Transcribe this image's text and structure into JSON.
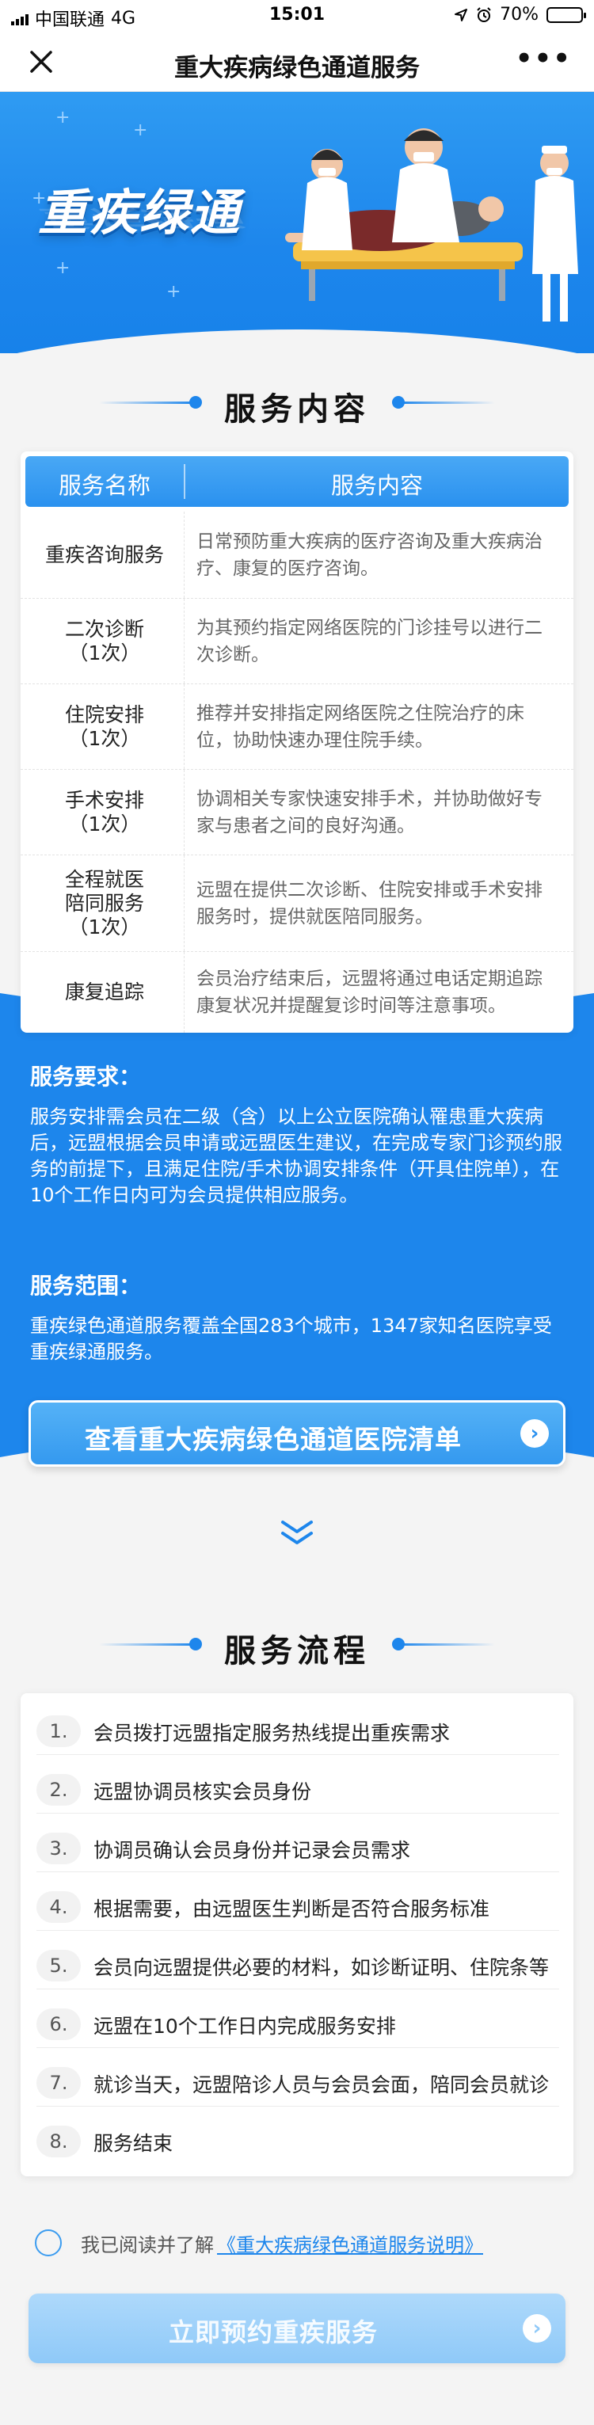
{
  "status_bar": {
    "carrier": "中国联通",
    "network": "4G",
    "time": "15:01",
    "battery": "70%",
    "battery_level": 0.7
  },
  "nav": {
    "title": "重大疾病绿色通道服务",
    "more": "•••"
  },
  "banner": {
    "title": "重疾绿通"
  },
  "service_section": {
    "heading": "服务内容",
    "header_name": "服务名称",
    "header_content": "服务内容",
    "rows": [
      {
        "name": "重疾咨询服务",
        "desc": "日常预防重大疾病的医疗咨询及重大疾病治疗、康复的医疗咨询。"
      },
      {
        "name": "二次诊断\n（1次）",
        "desc": "为其预约指定网络医院的门诊挂号以进行二次诊断。"
      },
      {
        "name": "住院安排\n（1次）",
        "desc": "推荐并安排指定网络医院之住院治疗的床位，协助快速办理住院手续。"
      },
      {
        "name": "手术安排\n（1次）",
        "desc": "协调相关专家快速安排手术，并协助做好专家与患者之间的良好沟通。"
      },
      {
        "name": "全程就医\n陪同服务\n（1次）",
        "desc": "远盟在提供二次诊断、住院安排或手术安排服务时，提供就医陪同服务。"
      },
      {
        "name": "康复追踪",
        "desc": "会员治疗结束后，远盟将通过电话定期追踪康复状况并提醒复诊时间等注意事项。"
      }
    ]
  },
  "requirement": {
    "title": "服务要求：",
    "text": "服务安排需会员在二级（含）以上公立医院确认罹患重大疾病后，远盟根据会员申请或远盟医生建议，在完成专家门诊预约服务的前提下，且满足住院/手术协调安排条件（开具住院单），在10个工作日内可为会员提供相应服务。"
  },
  "scope": {
    "title": "服务范围：",
    "text": "重疾绿色通道服务覆盖全国283个城市，1347家知名医院享受重疾绿通服务。"
  },
  "hospital_button": {
    "label": "查看重大疾病绿色通道医院清单"
  },
  "process_section": {
    "heading": "服务流程",
    "steps": [
      {
        "num": "1.",
        "text": "会员拨打远盟指定服务热线提出重疾需求"
      },
      {
        "num": "2.",
        "text": "远盟协调员核实会员身份"
      },
      {
        "num": "3.",
        "text": "协调员确认会员身份并记录会员需求"
      },
      {
        "num": "4.",
        "text": "根据需要，由远盟医生判断是否符合服务标准"
      },
      {
        "num": "5.",
        "text": "会员向远盟提供必要的材料，如诊断证明、住院条等"
      },
      {
        "num": "6.",
        "text": "远盟在10个工作日内完成服务安排"
      },
      {
        "num": "7.",
        "text": "就诊当天，远盟陪诊人员与会员会面，陪同会员就诊"
      },
      {
        "num": "8.",
        "text": "服务结束"
      }
    ]
  },
  "agreement": {
    "prefix": "我已阅读并了解",
    "link": "《重大疾病绿色通道服务说明》"
  },
  "book_button": {
    "label": "立即预约重疾服务"
  },
  "colors": {
    "primary": "#1d86ec",
    "button_disabled": "#8fc9f8"
  }
}
